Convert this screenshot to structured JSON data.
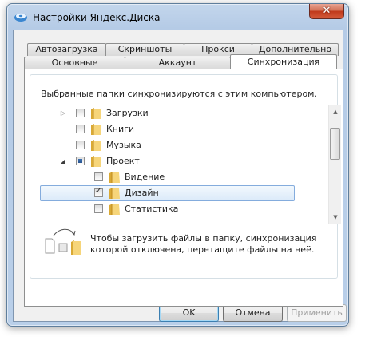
{
  "window": {
    "title": "Настройки Яндекс.Диска",
    "close_label": "✕"
  },
  "tabs": {
    "row_top": [
      "Автозагрузка",
      "Скриншоты",
      "Прокси",
      "Дополнительно"
    ],
    "row_bottom": [
      "Основные",
      "Аккаунт",
      "Синхронизация"
    ],
    "active": "Синхронизация"
  },
  "sync": {
    "description": "Выбранные папки синхронизируются с этим компьютером.",
    "folders": [
      {
        "label": "Загрузки",
        "level": 0,
        "expander": "▷",
        "state": "unchecked",
        "selected": false
      },
      {
        "label": "Книги",
        "level": 0,
        "expander": "",
        "state": "unchecked",
        "selected": false
      },
      {
        "label": "Музыка",
        "level": 0,
        "expander": "",
        "state": "unchecked",
        "selected": false
      },
      {
        "label": "Проект",
        "level": 0,
        "expander": "◢",
        "state": "partial",
        "selected": false
      },
      {
        "label": "Видение",
        "level": 1,
        "expander": "",
        "state": "unchecked",
        "selected": false
      },
      {
        "label": "Дизайн",
        "level": 1,
        "expander": "",
        "state": "checked",
        "selected": true
      },
      {
        "label": "Статистика",
        "level": 1,
        "expander": "",
        "state": "unchecked",
        "selected": false
      }
    ],
    "hint": "Чтобы загрузить файлы в папку, синхронизация которой отключена, перетащите файлы на неё."
  },
  "buttons": {
    "ok": "OK",
    "cancel": "Отмена",
    "apply": "Применить"
  }
}
